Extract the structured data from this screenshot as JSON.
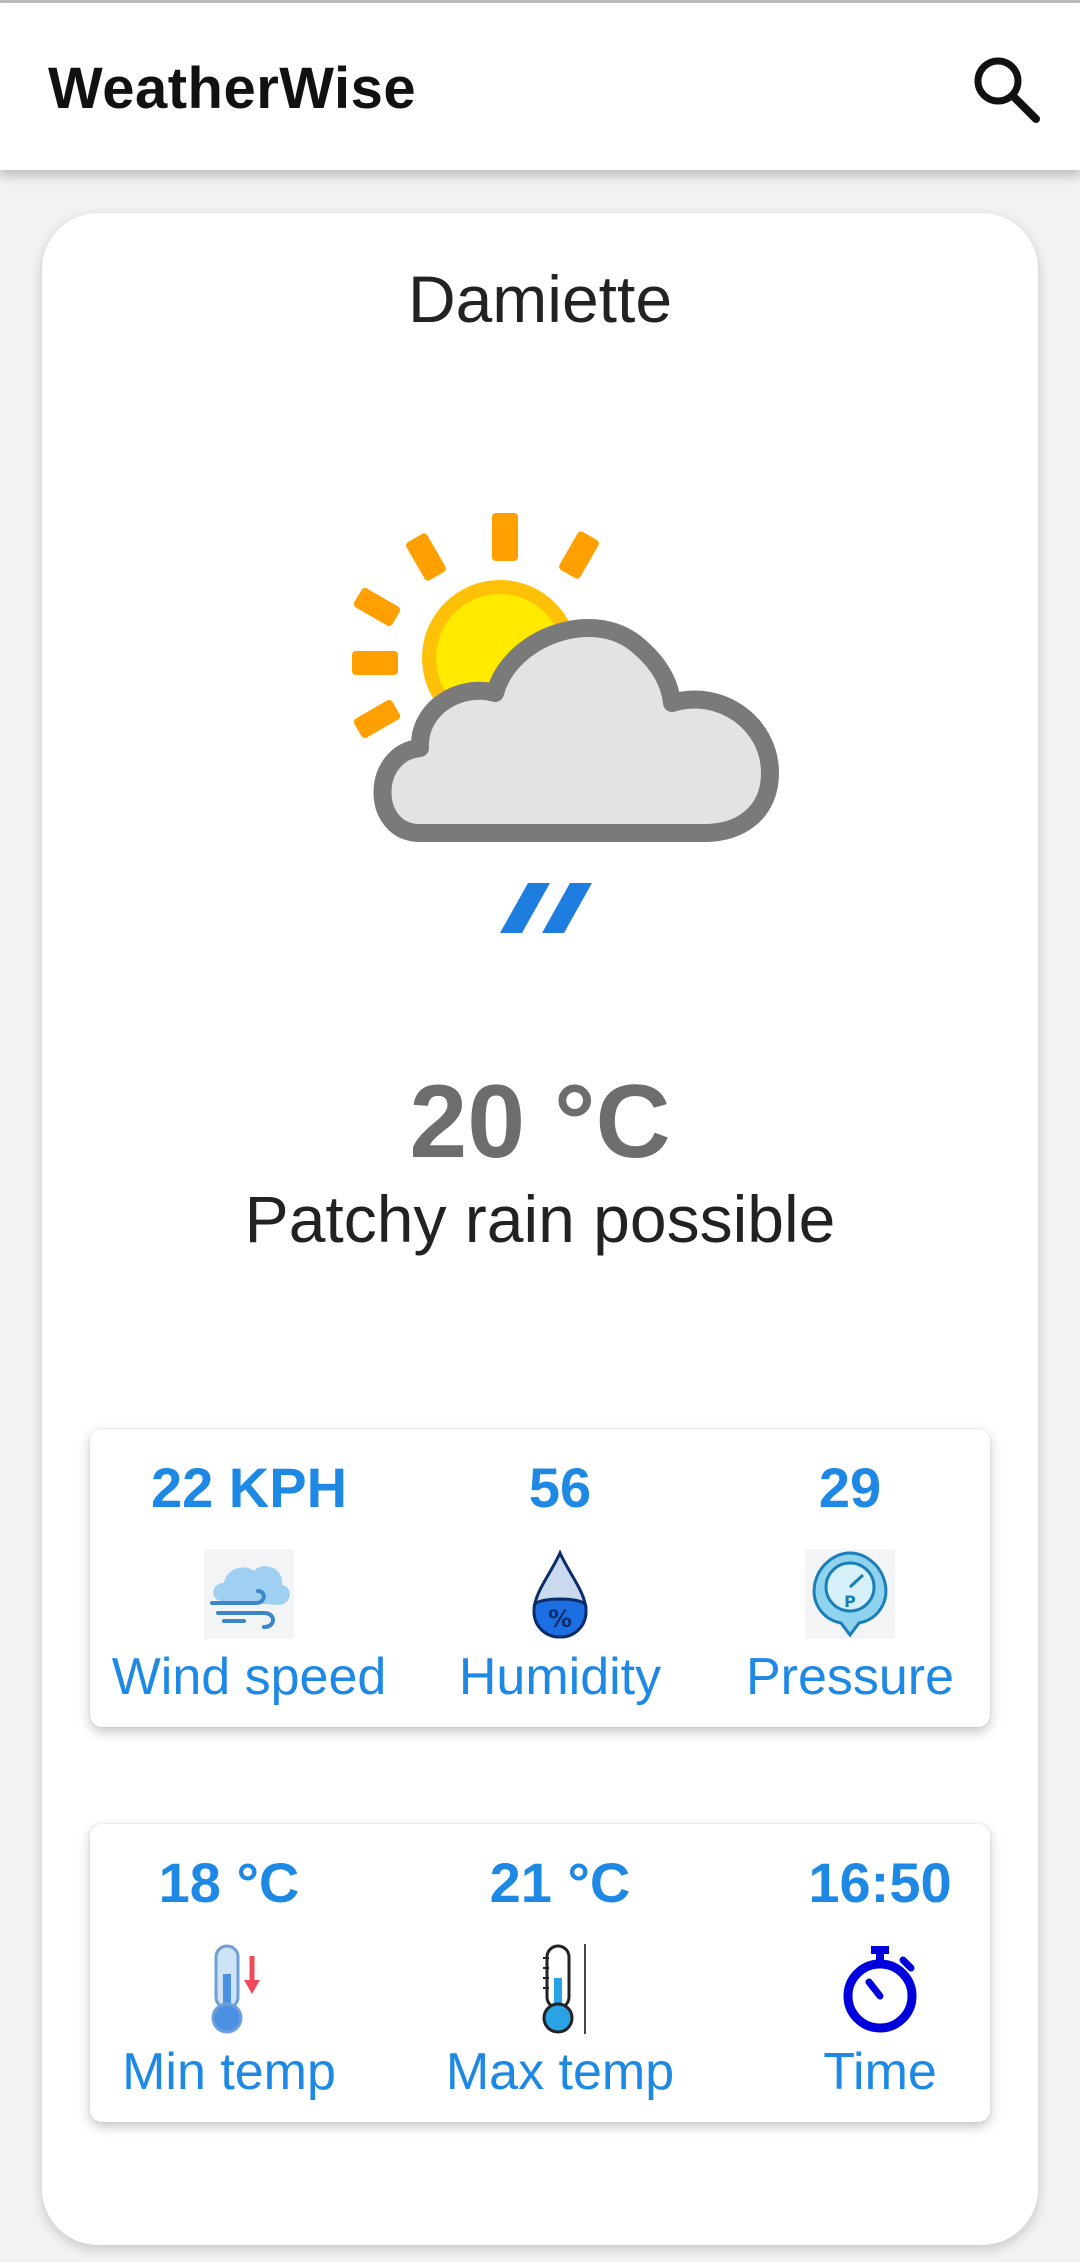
{
  "app": {
    "title": "WeatherWise"
  },
  "header": {
    "search_icon": "search-icon"
  },
  "current": {
    "city": "Damiette",
    "temperature": "20 °C",
    "condition": "Patchy rain possible",
    "icon": "sun-cloud-rain-icon"
  },
  "stats_row1": {
    "wind": {
      "value": "22 KPH",
      "label": "Wind speed",
      "icon": "wind-icon"
    },
    "humidity": {
      "value": "56",
      "label": "Humidity",
      "icon": "humidity-drop-icon"
    },
    "pressure": {
      "value": "29",
      "label": "Pressure",
      "icon": "pressure-gauge-icon"
    }
  },
  "stats_row2": {
    "min_temp": {
      "value": "18 °C",
      "label": "Min temp",
      "icon": "thermometer-low-icon"
    },
    "max_temp": {
      "value": "21 °C",
      "label": "Max temp",
      "icon": "thermometer-high-icon"
    },
    "time": {
      "value": "16:50",
      "label": "Time",
      "icon": "stopwatch-icon"
    }
  },
  "colors": {
    "accent": "#1e88e5",
    "temp_text": "#6d6d6d",
    "sun": "#ffd600",
    "sun_rays": "#ffa000",
    "cloud": "#e3e3e3",
    "cloud_outline": "#7a7a7a",
    "rain": "#1e7ee0"
  }
}
